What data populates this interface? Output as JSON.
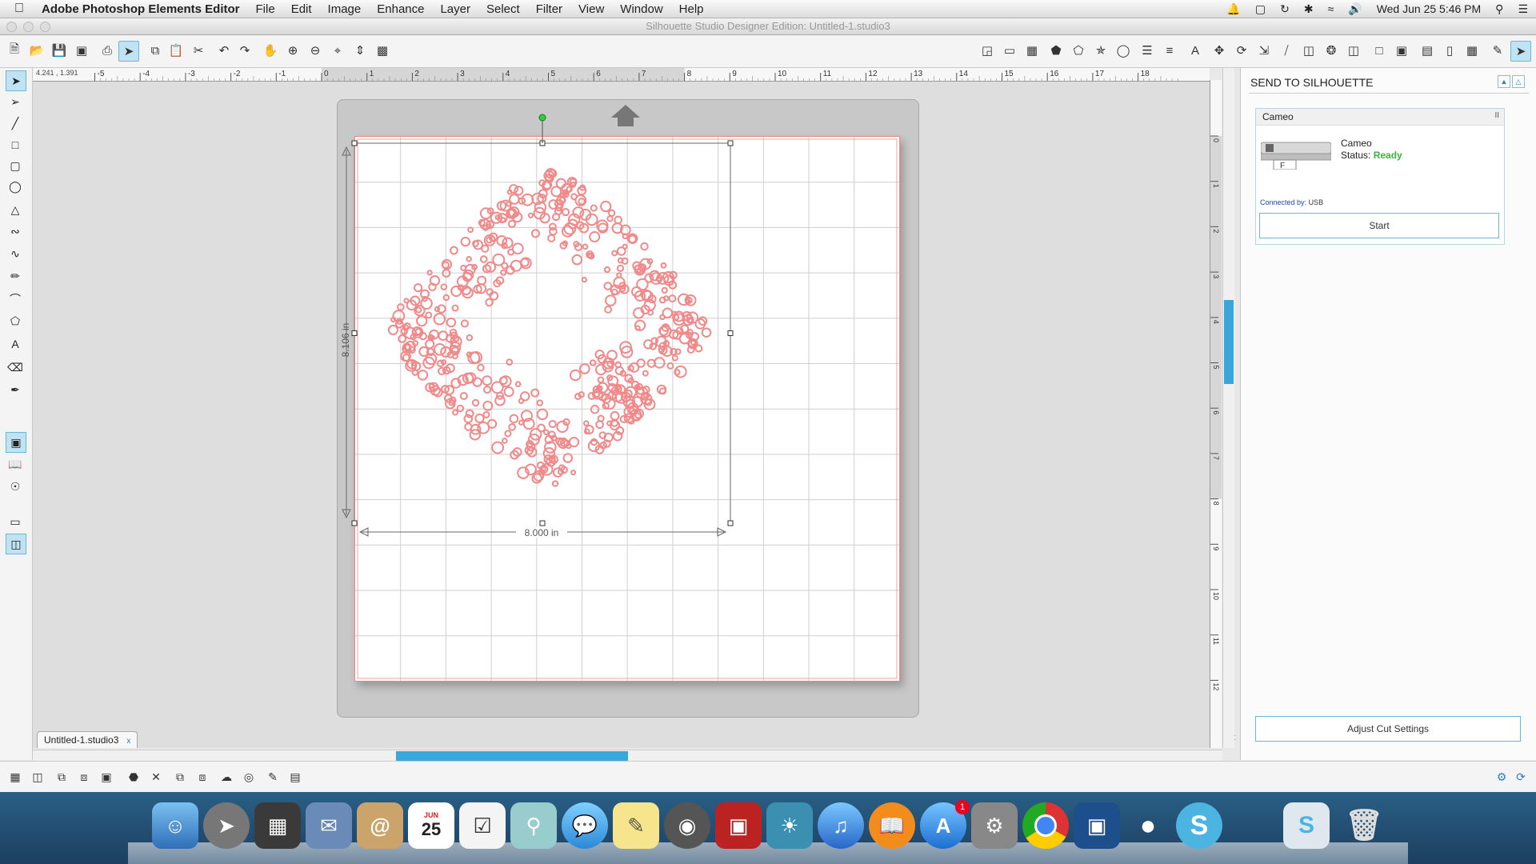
{
  "menubar": {
    "app": "Adobe Photoshop Elements Editor",
    "items": [
      "File",
      "Edit",
      "Image",
      "Enhance",
      "Layer",
      "Select",
      "Filter",
      "View",
      "Window",
      "Help"
    ],
    "clock": "Wed Jun 25  5:46 PM"
  },
  "window": {
    "title": "Silhouette Studio Designer Edition: Untitled-1.studio3"
  },
  "ruler": {
    "coords": "4.241 , 1.391",
    "h_ticks": [
      "-5",
      "-4",
      "-3",
      "-2",
      "-1",
      "0",
      "1",
      "2",
      "3",
      "4",
      "5",
      "6",
      "7",
      "8",
      "9",
      "10",
      "11",
      "12",
      "13",
      "14",
      "15",
      "16",
      "17",
      "18"
    ],
    "v_ticks": [
      "0",
      "1",
      "2",
      "3",
      "4",
      "5",
      "6",
      "7",
      "8",
      "9",
      "10",
      "11",
      "12"
    ]
  },
  "design": {
    "height_label": "8.106 in",
    "width_label": "8.000 in",
    "cut_color": "#f08a8a"
  },
  "document_tab": {
    "label": "Untitled-1.studio3",
    "close": "x"
  },
  "panel": {
    "title": "SEND TO SILHOUETTE",
    "device_header": "Cameo",
    "device_name": "Cameo",
    "status_label": "Status:",
    "status_value": "Ready",
    "connected_label": "Connected by:",
    "connected_value": "USB",
    "start": "Start",
    "adjust": "Adjust Cut Settings",
    "pause": "II"
  },
  "dock": {
    "calendar_month": "JUN",
    "calendar_day": "25",
    "badge": "1"
  }
}
